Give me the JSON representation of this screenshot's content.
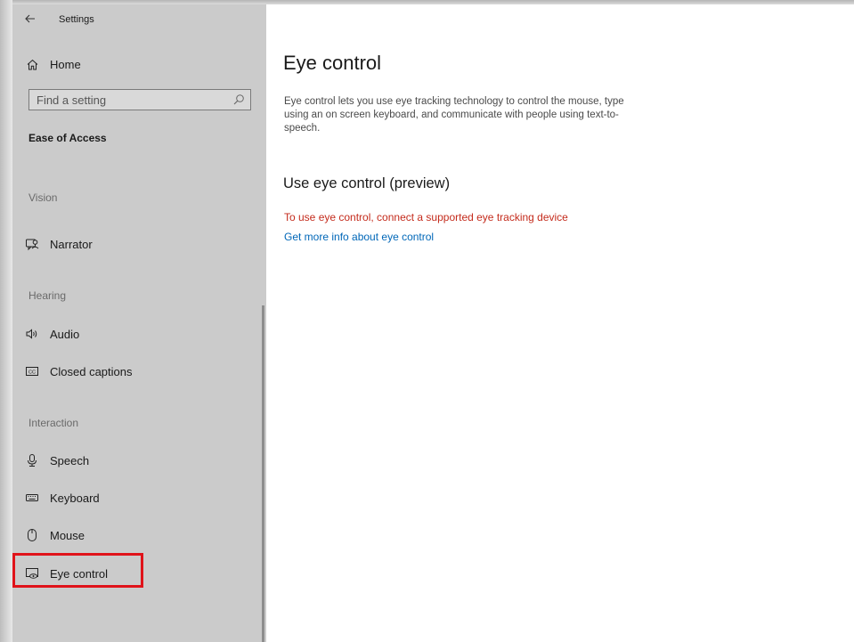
{
  "app": {
    "title": "Settings"
  },
  "sidebar": {
    "home_label": "Home",
    "search": {
      "placeholder": "Find a setting",
      "value": ""
    },
    "section_title": "Ease of Access",
    "groups": {
      "vision": {
        "header": "Vision",
        "items": [
          {
            "label": "Narrator",
            "icon": "narrator-icon"
          }
        ]
      },
      "hearing": {
        "header": "Hearing",
        "items": [
          {
            "label": "Audio",
            "icon": "speaker-icon"
          },
          {
            "label": "Closed captions",
            "icon": "closed-captions-icon"
          }
        ]
      },
      "interaction": {
        "header": "Interaction",
        "items": [
          {
            "label": "Speech",
            "icon": "microphone-icon"
          },
          {
            "label": "Keyboard",
            "icon": "keyboard-icon"
          },
          {
            "label": "Mouse",
            "icon": "mouse-icon"
          },
          {
            "label": "Eye control",
            "icon": "eye-control-icon"
          }
        ]
      }
    },
    "selected": "Eye control",
    "highlight_color": "#e0131a"
  },
  "main": {
    "page_title": "Eye control",
    "description": "Eye control lets you use eye tracking technology to control the mouse, type using an on screen keyboard, and communicate with people using text-to-speech.",
    "subheading": "Use eye control (preview)",
    "error_message": "To use eye control, connect a supported eye tracking device",
    "info_link": "Get more info about eye control"
  },
  "colors": {
    "sidebar_bg": "#cbcbcb",
    "error": "#c42b1c",
    "link": "#0067b8"
  }
}
